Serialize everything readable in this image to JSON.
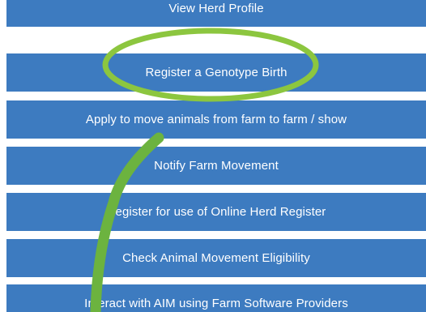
{
  "menu": {
    "items": [
      {
        "label": "View Herd Profile"
      },
      {
        "label": "Register a Genotype Birth"
      },
      {
        "label": "Apply to move animals from farm to farm / show"
      },
      {
        "label": "Notify Farm Movement"
      },
      {
        "label": "Register for use of Online Herd Register"
      },
      {
        "label": "Check Animal Movement Eligibility"
      },
      {
        "label": "Interact with AIM using Farm Software Providers"
      }
    ]
  },
  "colors": {
    "button_blue": "#3d7bc0",
    "button_text": "#ffffff",
    "highlight_green": "#8cc63f"
  }
}
